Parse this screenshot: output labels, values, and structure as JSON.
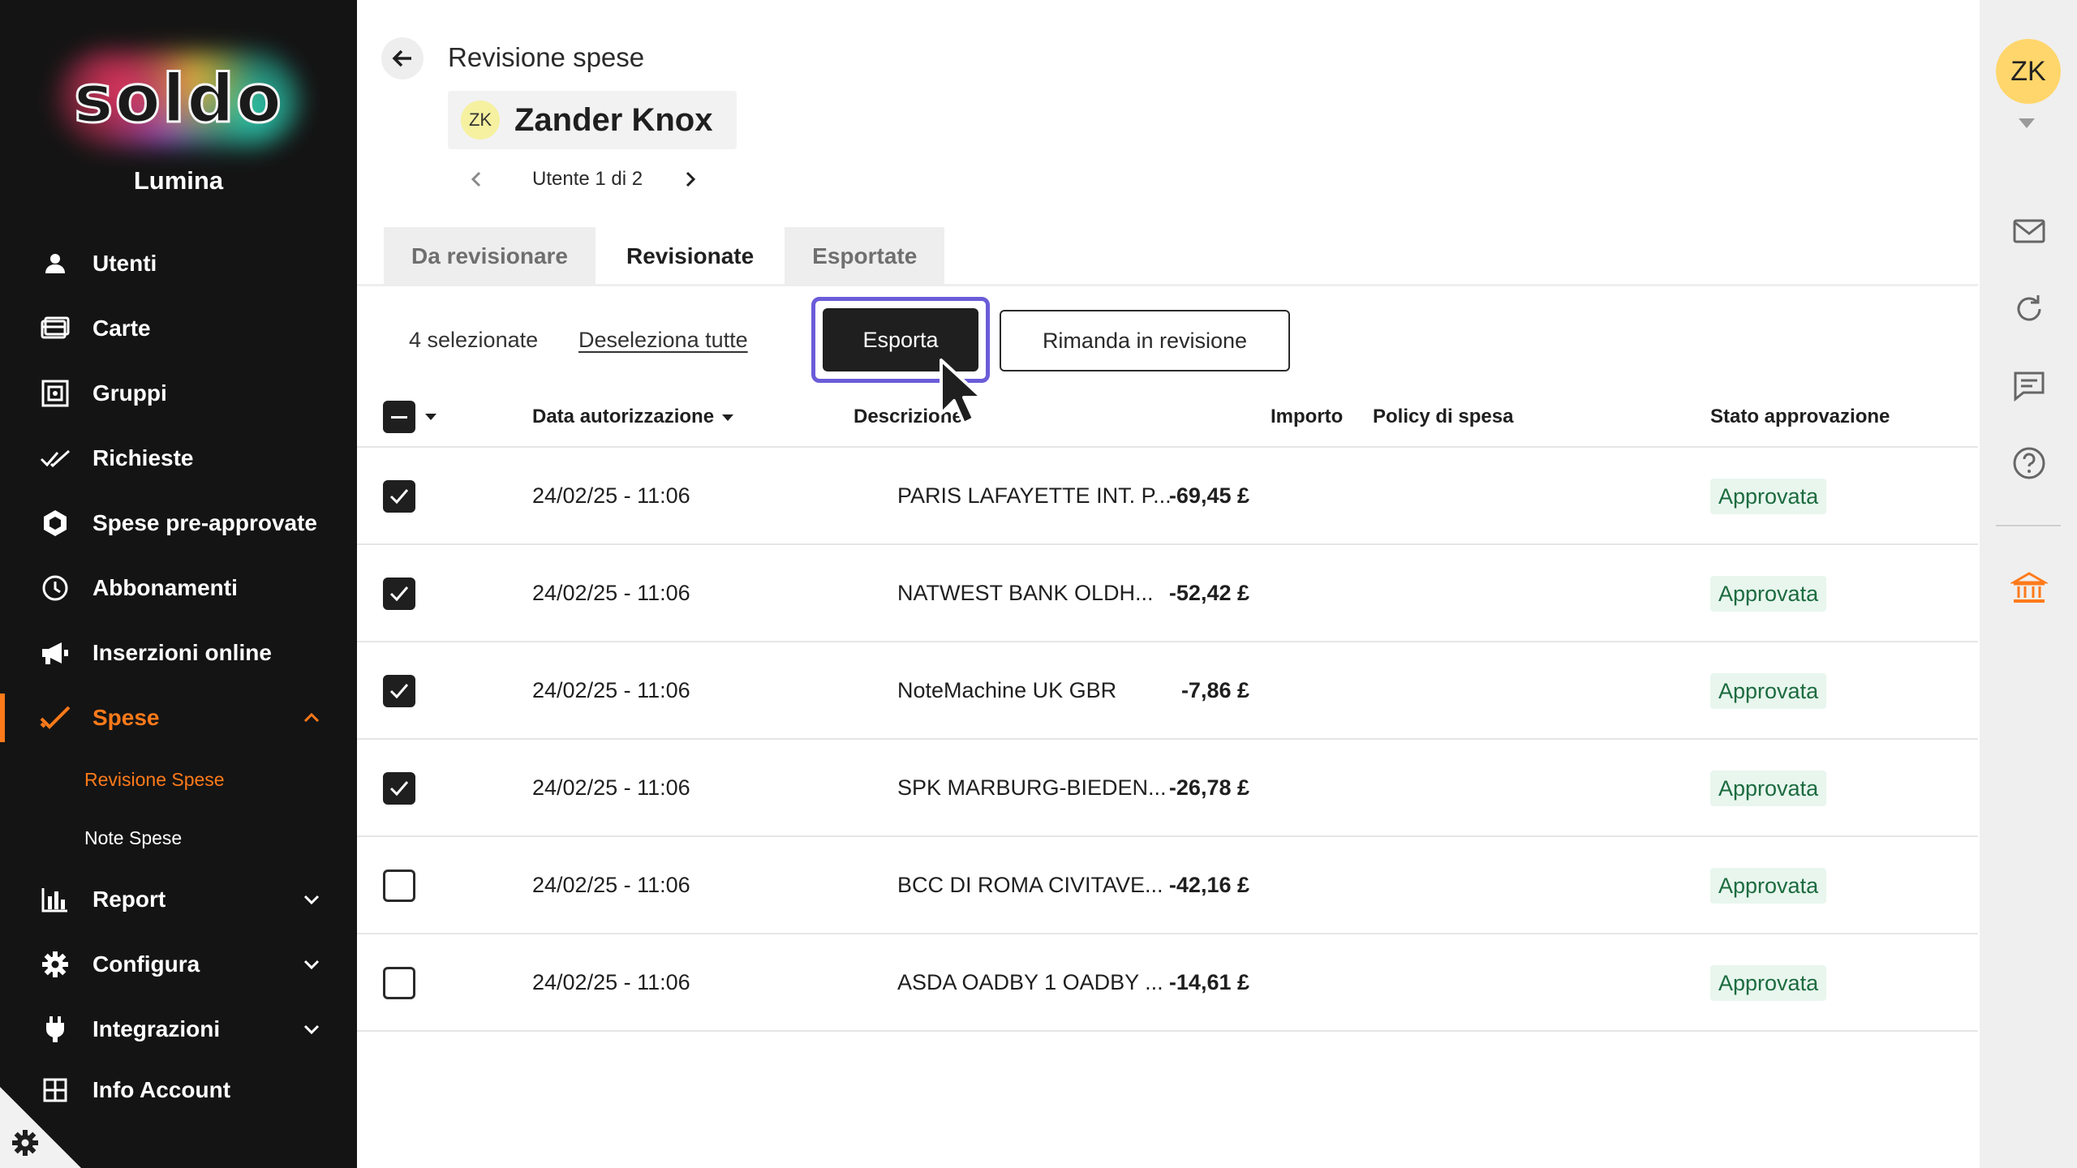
{
  "sidebar": {
    "logo_text": "soldo",
    "company": "Lumina",
    "items": [
      {
        "label": "Utenti",
        "icon": "user-icon"
      },
      {
        "label": "Carte",
        "icon": "card-icon"
      },
      {
        "label": "Gruppi",
        "icon": "groups-icon"
      },
      {
        "label": "Richieste",
        "icon": "double-check-icon"
      },
      {
        "label": "Spese pre-approvate",
        "icon": "hexagon-icon"
      },
      {
        "label": "Abbonamenti",
        "icon": "clock-icon"
      },
      {
        "label": "Inserzioni online",
        "icon": "megaphone-icon"
      },
      {
        "label": "Spese",
        "icon": "check-icon",
        "active": true,
        "expanded": true
      },
      {
        "label": "Report",
        "icon": "bar-chart-icon"
      },
      {
        "label": "Configura",
        "icon": "gear-icon"
      },
      {
        "label": "Integrazioni",
        "icon": "plug-icon"
      },
      {
        "label": "Info Account",
        "icon": "grid-icon"
      }
    ],
    "sub_items": [
      {
        "label": "Revisione Spese",
        "active": true
      },
      {
        "label": "Note Spese"
      }
    ]
  },
  "header": {
    "title": "Revisione spese",
    "user_initials": "ZK",
    "user_name": "Zander Knox",
    "pager": "Utente 1 di 2"
  },
  "tabs": [
    {
      "label": "Da revisionare"
    },
    {
      "label": "Revisionate",
      "active": true
    },
    {
      "label": "Esportate"
    }
  ],
  "toolbar": {
    "selected_count": "4 selezionate",
    "deselect_all": "Deseleziona tutte",
    "export": "Esporta",
    "send_back": "Rimanda in revisione"
  },
  "table": {
    "columns": {
      "date": "Data autorizzazione",
      "description": "Descrizione",
      "amount": "Importo",
      "policy": "Policy di spesa",
      "status": "Stato approvazione"
    },
    "rows": [
      {
        "checked": true,
        "date": "24/02/25 - 11:06",
        "description": "PARIS LAFAYETTE INT. P...",
        "amount": "-69,45 £",
        "status": "Approvata"
      },
      {
        "checked": true,
        "date": "24/02/25 - 11:06",
        "description": "NATWEST BANK OLDH...",
        "amount": "-52,42 £",
        "status": "Approvata"
      },
      {
        "checked": true,
        "date": "24/02/25 - 11:06",
        "description": "NoteMachine UK GBR",
        "amount": "-7,86 £",
        "status": "Approvata"
      },
      {
        "checked": true,
        "date": "24/02/25 - 11:06",
        "description": "SPK MARBURG-BIEDEN...",
        "amount": "-26,78 £",
        "status": "Approvata"
      },
      {
        "checked": false,
        "date": "24/02/25 - 11:06",
        "description": "BCC DI ROMA CIVITAVE...",
        "amount": "-42,16 £",
        "status": "Approvata"
      },
      {
        "checked": false,
        "date": "24/02/25 - 11:06",
        "description": "ASDA OADBY 1 OADBY ...",
        "amount": "-14,61 £",
        "status": "Approvata"
      }
    ]
  },
  "rail": {
    "avatar_initials": "ZK",
    "icons": [
      "mail-icon",
      "refresh-icon",
      "chat-icon",
      "help-icon",
      "bank-icon"
    ]
  },
  "colors": {
    "accent": "#ff7a1a",
    "sidebar_bg": "#141414",
    "focus_ring": "#6b5cd9",
    "badge_bg": "#e8f6ee",
    "badge_text": "#1c6b3f"
  }
}
